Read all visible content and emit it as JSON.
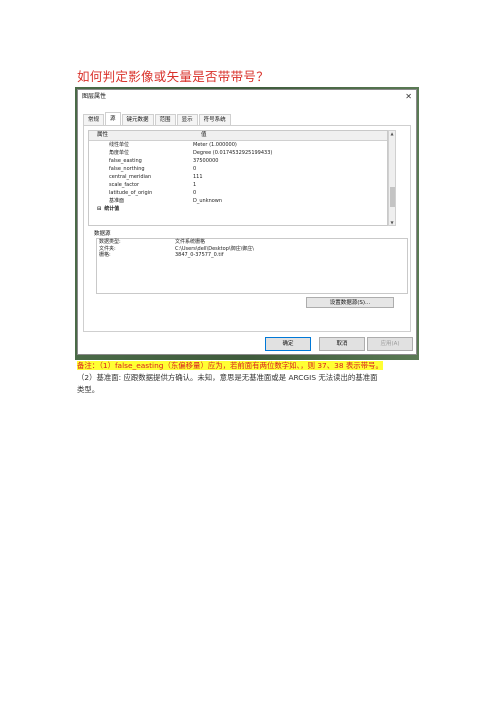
{
  "doc": {
    "title": "如何判定影像或矢量是否带带号？",
    "note_line1": "备注：（1）false_easting（东偏移量）应为，若前面有两位数字如、，则 37、38 表示带号。",
    "note_line2": "（2）基准面: 应跟数据提供方确认。未知，意思是无基准面或是 ARCGIS 无法读出的基准面",
    "note_line3": "类型。"
  },
  "dialog": {
    "title": "图层属性",
    "close_glyph": "✕",
    "tabs": [
      "常规",
      "源",
      "键元数据",
      "范围",
      "显示",
      "符号系统"
    ],
    "active_tab": "源",
    "prop_header": {
      "col1": "属性",
      "col2": "值"
    },
    "prop_rows": [
      {
        "name": "线性单位",
        "value": "Meter (1.000000)"
      },
      {
        "name": "角度单位",
        "value": "Degree (0.0174532925199433)"
      },
      {
        "name": "false_easting",
        "value": "37500000"
      },
      {
        "name": "false_northing",
        "value": "0"
      },
      {
        "name": "central_meridian",
        "value": "111"
      },
      {
        "name": "scale_factor",
        "value": "1"
      },
      {
        "name": "latitude_of_origin",
        "value": "0"
      },
      {
        "name": "基准面",
        "value": "D_unknown"
      }
    ],
    "group_row": {
      "expander": "⊟",
      "name": "统计值"
    },
    "datasource_label": "数据源",
    "datasource_rows": [
      {
        "key": "数据类型:",
        "value": "文件系统栅格"
      },
      {
        "key": "文件夹:",
        "value": "C:\\Users\\dell\\Desktop\\御庄\\御庄\\"
      },
      {
        "key": "栅格:",
        "value": "3847_0-37577_0.tif"
      }
    ],
    "set_datasource_button": "设置数据源(S)...",
    "ok_button": "确定",
    "cancel_button": "取消",
    "apply_button": "应用(A)"
  },
  "colors": {
    "title_red": "#d9322b",
    "highlight_yellow": "#ffff33",
    "note_red": "#d82020"
  }
}
